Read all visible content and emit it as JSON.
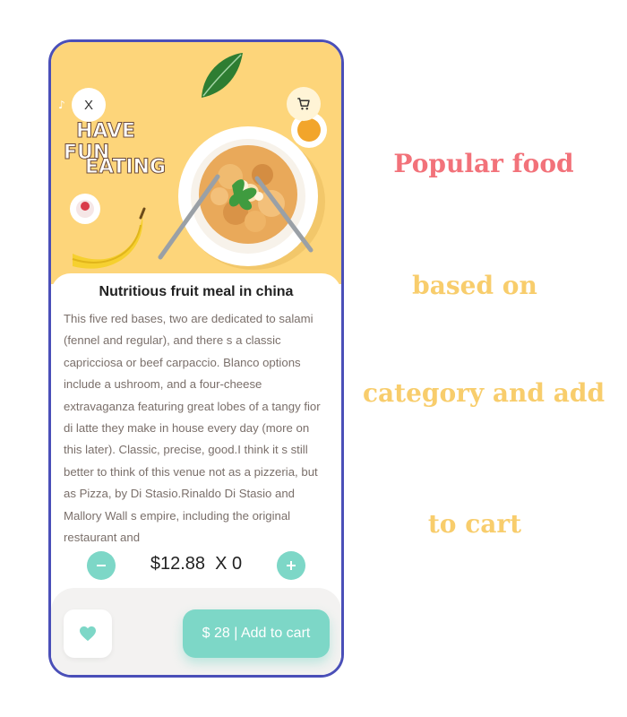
{
  "product": {
    "close_label": "X",
    "title": "Nutritious fruit meal in china",
    "description": "This five red bases, two are dedicated to salami (fennel and regular), and there s a classic capricciosa or beef carpaccio. Blanco options include a ushroom, and a four-cheese extravaganza featuring great lobes of a tangy fior di latte they make in house every day (more on this later). Classic, precise, good.I think it s still better to think of this venue not as a pizzeria, but as Pizza, by Di Stasio.Rinaldo Di Stasio and Mallory Wall s empire, including the original restaurant and",
    "price": "$12.88",
    "quantity": "X 0",
    "add_to_cart": "$ 28 | Add to cart"
  },
  "hero_text": [
    "HAVE",
    "FUN",
    "EATING"
  ],
  "icons": {
    "close": "close-icon",
    "cart": "cart-icon",
    "minus": "minus-icon",
    "plus": "plus-icon",
    "favorite": "heart-icon"
  },
  "captions": {
    "line1": "Popular food",
    "line2": "based on",
    "line3": "category and add",
    "line4": "to cart"
  },
  "colors": {
    "hero_bg": "#fdd57a",
    "accent": "#7dd7c7",
    "frame": "#4a4fb8",
    "caption_pink": "#f2727a",
    "caption_yellow": "#f8cd6c"
  }
}
